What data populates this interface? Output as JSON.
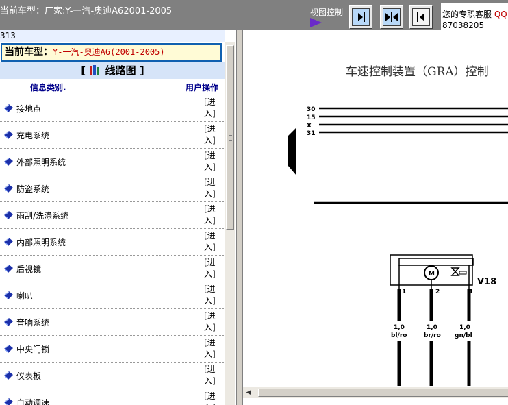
{
  "header": {
    "breadcrumb": "当前车型：厂家:Y-一汽-奥迪A62001-2005",
    "view_control_label": "视图控制",
    "customer_service": {
      "label": "您的专职客服",
      "suffix": "QQ",
      "phone": "87038205"
    }
  },
  "left": {
    "page_number": "313",
    "car_model": {
      "label": "当前车型：",
      "value": "Y-一汽-奥迪A6(2001-2005)"
    },
    "section_title": "线路图",
    "section_bracket_open": "[",
    "section_bracket_close": "]",
    "columns": {
      "category": "信息类别.",
      "action": "用户操作"
    },
    "action_line1": "[进",
    "action_line2": "入]",
    "items": [
      "接地点",
      "充电系统",
      "外部照明系统",
      "防盗系统",
      "雨刮/洗涤系统",
      "内部照明系统",
      "后视镜",
      "喇叭",
      "音响系统",
      "中央门锁",
      "仪表板",
      "自动调速"
    ]
  },
  "diagram": {
    "title": "车速控制装置（GRA）控制",
    "rails": [
      "30",
      "15",
      "X",
      "31"
    ],
    "component": "V18",
    "pins": [
      "1",
      "2",
      "3"
    ],
    "wire_gauges": [
      "1,0",
      "1,0",
      "1,0"
    ],
    "wire_colors": [
      "bl/ro",
      "br/ro",
      "gn/bl"
    ]
  },
  "colors": {
    "header_bg": "#808080",
    "accent_red": "#c00000",
    "link_blue": "#00008b",
    "button_blue": "#b8d8f8"
  }
}
